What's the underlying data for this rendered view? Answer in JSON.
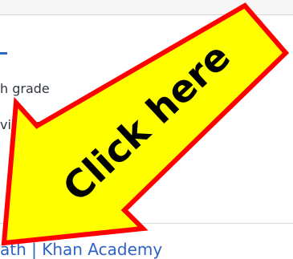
{
  "lines": {
    "line1": "h grade",
    "line2": "videos",
    "link": "ath | Khan Academy"
  },
  "overlay": {
    "arrow_text": "Click here",
    "arrow_fill": "#ffff00",
    "arrow_stroke": "#ff0000"
  }
}
